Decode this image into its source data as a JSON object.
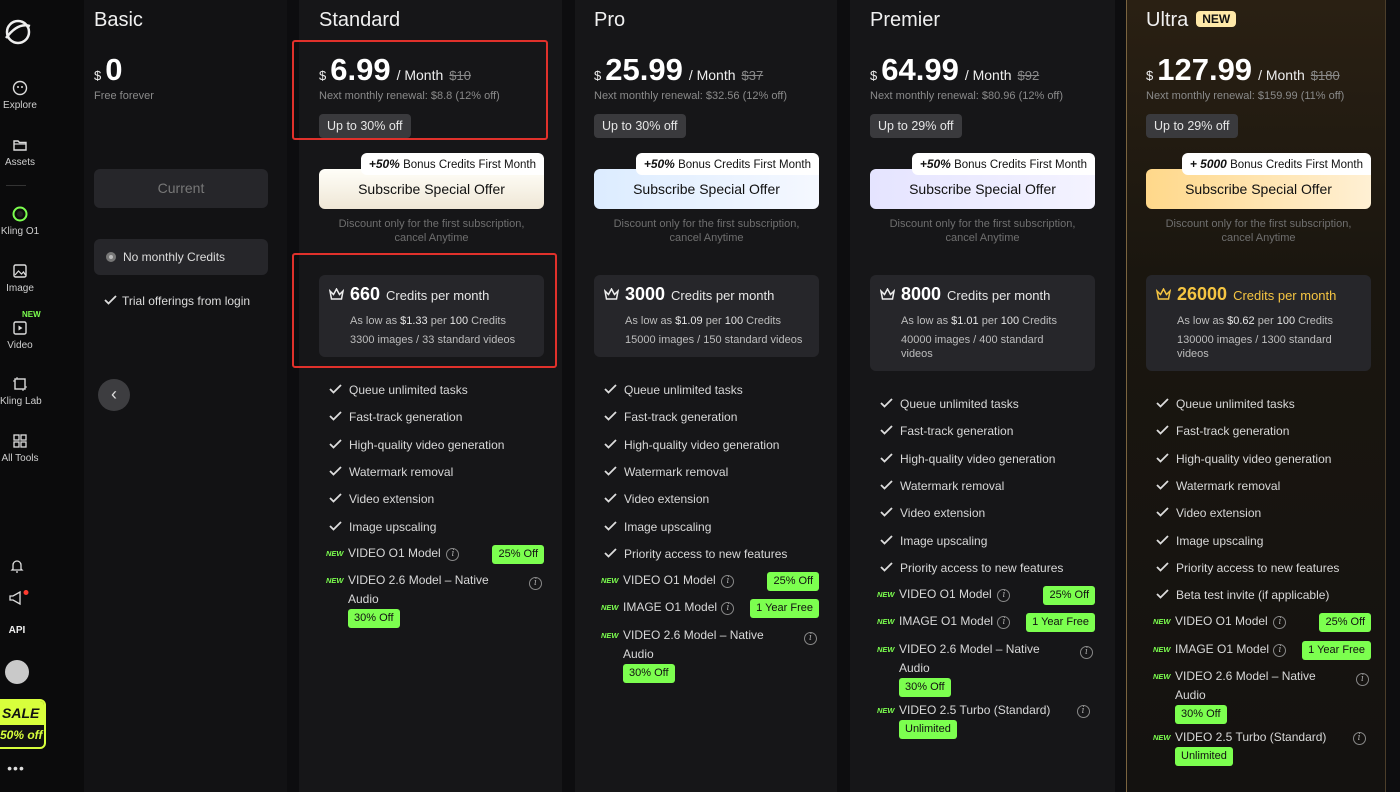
{
  "sidebar": {
    "items": [
      {
        "label": "Explore",
        "icon": "explore-icon"
      },
      {
        "label": "Assets",
        "icon": "folder-icon"
      },
      {
        "label": "Kling O1",
        "icon": "kling-o1-icon"
      },
      {
        "label": "Image",
        "icon": "image-icon"
      },
      {
        "label": "Video",
        "icon": "video-icon",
        "badge": "NEW"
      },
      {
        "label": "Kling Lab",
        "icon": "lab-icon"
      },
      {
        "label": "All Tools",
        "icon": "grid-icon"
      }
    ],
    "api_label": "API",
    "sale": {
      "line1": "SALE",
      "line2": "50% off"
    },
    "more": "•••"
  },
  "basic": {
    "title": "Basic",
    "currency": "$",
    "price": "0",
    "subtitle": "Free forever",
    "current_label": "Current",
    "no_monthly": "No monthly Credits",
    "trial": "Trial offerings from login"
  },
  "plans": [
    {
      "title": "Standard",
      "currency": "$",
      "price": "6.99",
      "per": "/ Month",
      "old_price": "$10",
      "renewal": "Next monthly renewal: $8.8 (12% off)",
      "upto": "Up to 30% off",
      "bonus_strong": "+50%",
      "bonus_text": "Bonus Credits First Month",
      "subscribe": "Subscribe Special Offer",
      "discount_note": [
        "Discount only for the first subscription,",
        "cancel Anytime"
      ],
      "credits": "660",
      "credits_label": "Credits per month",
      "low_prefix": "As low as",
      "low_price": "$1.33",
      "low_mid": "per",
      "low_qty": "100",
      "low_suffix": "Credits",
      "capacity": [
        "3300 images / 33 standard videos"
      ],
      "features": [
        "Queue unlimited tasks",
        "Fast-track generation",
        "High-quality video generation",
        "Watermark removal",
        "Video extension",
        "Image upscaling"
      ],
      "extras": [
        {
          "new": "NEW",
          "text": [
            "VIDEO O1 Model"
          ],
          "badge": "25% Off"
        },
        {
          "new": "NEW",
          "text": [
            "VIDEO 2.6 Model – Native",
            "Audio"
          ],
          "badge": "30% Off"
        }
      ]
    },
    {
      "title": "Pro",
      "currency": "$",
      "price": "25.99",
      "per": "/ Month",
      "old_price": "$37",
      "renewal": "Next monthly renewal: $32.56 (12% off)",
      "upto": "Up to 30% off",
      "bonus_strong": "+50%",
      "bonus_text": "Bonus Credits First Month",
      "subscribe": "Subscribe Special Offer",
      "discount_note": [
        "Discount only for the first subscription,",
        "cancel Anytime"
      ],
      "credits": "3000",
      "credits_label": "Credits per month",
      "low_prefix": "As low as",
      "low_price": "$1.09",
      "low_mid": "per",
      "low_qty": "100",
      "low_suffix": "Credits",
      "capacity": [
        "15000 images / 150 standard videos"
      ],
      "features": [
        "Queue unlimited tasks",
        "Fast-track generation",
        "High-quality video generation",
        "Watermark removal",
        "Video extension",
        "Image upscaling",
        "Priority access to new features"
      ],
      "extras": [
        {
          "new": "NEW",
          "text": [
            "VIDEO O1 Model"
          ],
          "badge": "25% Off"
        },
        {
          "new": "NEW",
          "text": [
            "IMAGE O1 Model"
          ],
          "badge": "1 Year Free"
        },
        {
          "new": "NEW",
          "text": [
            "VIDEO 2.6 Model – Native",
            "Audio"
          ],
          "badge": "30% Off"
        }
      ]
    },
    {
      "title": "Premier",
      "currency": "$",
      "price": "64.99",
      "per": "/ Month",
      "old_price": "$92",
      "renewal": "Next monthly renewal: $80.96 (12% off)",
      "upto": "Up to 29% off",
      "bonus_strong": "+50%",
      "bonus_text": "Bonus Credits First Month",
      "subscribe": "Subscribe Special Offer",
      "discount_note": [
        "Discount only for the first subscription,",
        "cancel Anytime"
      ],
      "credits": "8000",
      "credits_label": "Credits per month",
      "low_prefix": "As low as",
      "low_price": "$1.01",
      "low_mid": "per",
      "low_qty": "100",
      "low_suffix": "Credits",
      "capacity": [
        "40000 images / 400 standard",
        "videos"
      ],
      "features": [
        "Queue unlimited tasks",
        "Fast-track generation",
        "High-quality video generation",
        "Watermark removal",
        "Video extension",
        "Image upscaling",
        "Priority access to new features"
      ],
      "extras": [
        {
          "new": "NEW",
          "text": [
            "VIDEO O1 Model"
          ],
          "badge": "25% Off"
        },
        {
          "new": "NEW",
          "text": [
            "IMAGE O1 Model"
          ],
          "badge": "1 Year Free"
        },
        {
          "new": "NEW",
          "text": [
            "VIDEO 2.6 Model – Native",
            "Audio"
          ],
          "badge": "30% Off"
        },
        {
          "new": "NEW",
          "text": [
            "VIDEO 2.5 Turbo (Standard)"
          ],
          "badge": "Unlimited"
        }
      ]
    },
    {
      "title": "Ultra",
      "title_badge": "NEW",
      "currency": "$",
      "price": "127.99",
      "per": "/ Month",
      "old_price": "$180",
      "renewal": "Next monthly renewal: $159.99 (11% off)",
      "upto": "Up to 29% off",
      "bonus_strong": "+ 5000",
      "bonus_text": "Bonus Credits First Month",
      "subscribe": "Subscribe Special Offer",
      "discount_note": [
        "Discount only for the first subscription,",
        "cancel Anytime"
      ],
      "credits": "26000",
      "credits_label": "Credits per month",
      "low_prefix": "As low as",
      "low_price": "$0.62",
      "low_mid": "per",
      "low_qty": "100",
      "low_suffix": "Credits",
      "capacity": [
        "130000 images / 1300 standard",
        "videos"
      ],
      "features": [
        "Queue unlimited tasks",
        "Fast-track generation",
        "High-quality video generation",
        "Watermark removal",
        "Video extension",
        "Image upscaling",
        "Priority access to new features",
        "Beta test invite (if applicable)"
      ],
      "extras": [
        {
          "new": "NEW",
          "text": [
            "VIDEO O1 Model"
          ],
          "badge": "25% Off"
        },
        {
          "new": "NEW",
          "text": [
            "IMAGE O1 Model"
          ],
          "badge": "1 Year Free"
        },
        {
          "new": "NEW",
          "text": [
            "VIDEO 2.6 Model – Native",
            "Audio"
          ],
          "badge": "30% Off"
        },
        {
          "new": "NEW",
          "text": [
            "VIDEO 2.5 Turbo (Standard)"
          ],
          "badge": "Unlimited"
        }
      ]
    }
  ],
  "colors": {
    "green_badge": "#7cff4f",
    "highlight_red": "#e0312b",
    "ultra_gold": "#f5c542"
  }
}
